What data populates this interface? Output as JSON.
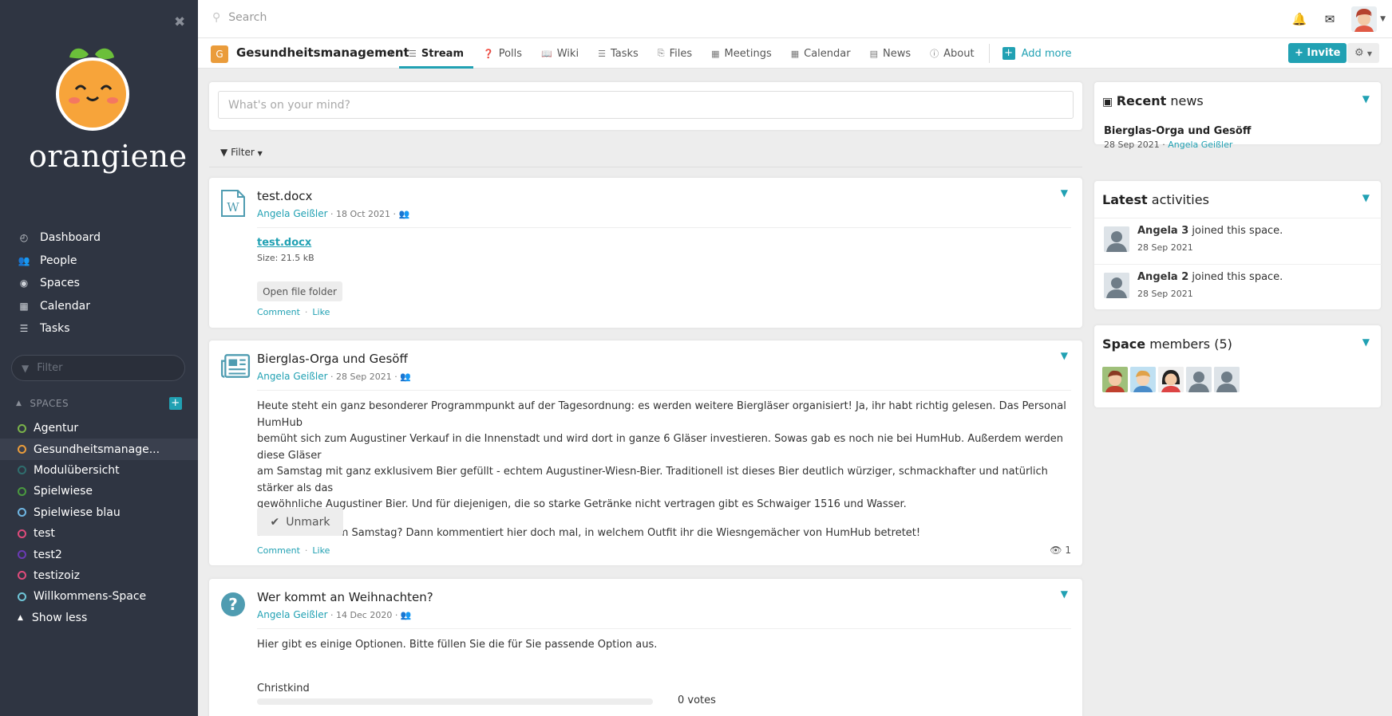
{
  "sidebar": {
    "brand": "orangiene",
    "nav": [
      {
        "label": "Dashboard",
        "icon": "dashboard-icon"
      },
      {
        "label": "People",
        "icon": "people-icon"
      },
      {
        "label": "Spaces",
        "icon": "spaces-icon"
      },
      {
        "label": "Calendar",
        "icon": "calendar-icon"
      },
      {
        "label": "Tasks",
        "icon": "tasks-icon"
      }
    ],
    "filter_placeholder": "Filter",
    "spaces_heading": "SPACES",
    "spaces": [
      {
        "label": "Agentur",
        "color": "#7ab34a"
      },
      {
        "label": "Gesundheitsmanage...",
        "color": "#ea9c3b"
      },
      {
        "label": "Modulübersicht",
        "color": "#2f6e6e"
      },
      {
        "label": "Spielwiese",
        "color": "#4a9a3f"
      },
      {
        "label": "Spielwiese blau",
        "color": "#6fb6e3"
      },
      {
        "label": "test",
        "color": "#e04b7b"
      },
      {
        "label": "test2",
        "color": "#6a3ab5"
      },
      {
        "label": "testizoiz",
        "color": "#e04b7b"
      },
      {
        "label": "Willkommens-Space",
        "color": "#6fc6d8"
      }
    ],
    "show_less": "Show less"
  },
  "topbar": {
    "search_placeholder": "Search"
  },
  "space": {
    "badge": "G",
    "name": "Gesundheitsmanagement",
    "tabs": [
      {
        "label": "Stream",
        "icon": "list-icon"
      },
      {
        "label": "Polls",
        "icon": "question-icon"
      },
      {
        "label": "Wiki",
        "icon": "book-icon"
      },
      {
        "label": "Tasks",
        "icon": "tasks-icon"
      },
      {
        "label": "Files",
        "icon": "files-icon"
      },
      {
        "label": "Meetings",
        "icon": "calendar-icon"
      },
      {
        "label": "Calendar",
        "icon": "calendar-icon"
      },
      {
        "label": "News",
        "icon": "news-icon"
      },
      {
        "label": "About",
        "icon": "info-icon"
      }
    ],
    "add_more": "Add more",
    "invite": "Invite"
  },
  "stream": {
    "composer_placeholder": "What's on your mind?",
    "filter_label": "Filter",
    "posts": [
      {
        "title": "test.docx",
        "author": "Angela Geißler",
        "date": "18 Oct 2021",
        "file_link": "test.docx",
        "file_size": "Size: 21.5 kB",
        "open_folder": "Open file folder",
        "comment": "Comment",
        "like": "Like"
      },
      {
        "title": "Bierglas-Orga und Gesöff",
        "author": "Angela Geißler",
        "date": "28 Sep 2021",
        "lines": [
          "Heute steht ein ganz besonderer Programmpunkt auf der Tagesordnung: es werden weitere Biergläser organisiert! Ja, ihr habt richtig gelesen. Das Personal HumHub",
          "bemüht sich zum Augustiner Verkauf in die Innenstadt und wird dort in ganze 6 Gläser investieren. Sowas gab es noch nie bei HumHub. Außerdem werden diese Gläser",
          "am Samstag mit ganz exklusivem Bier gefüllt - echtem Augustiner-Wiesn-Bier. Traditionell ist dieses Bier deutlich würziger, schmackhafter und natürlich stärker als das",
          "gewöhnliche Augustiner Bier. Und für diejenigen, die so starke Getränke nicht vertragen gibt es Schwaiger 1516 und Wasser."
        ],
        "paragraph2": "Seid ihr dabei am Samstag? Dann kommentiert hier doch mal, in welchem Outfit ihr die Wiesngemächer von HumHub betretet!",
        "unmark": "Unmark",
        "comment": "Comment",
        "like": "Like",
        "views": "1"
      },
      {
        "title": "Wer kommt an Weihnachten?",
        "author": "Angela Geißler",
        "date": "14 Dec 2020",
        "text": "Hier gibt es einige Optionen. Bitte füllen Sie die für Sie passende Option aus.",
        "option_label": "Christkind",
        "option_votes": "0 votes",
        "option_progress": 0
      }
    ]
  },
  "right": {
    "recent_news": {
      "title_bold": "Recent",
      "title_rest": "news",
      "item_title": "Bierglas-Orga und Gesöff",
      "item_date": "28 Sep 2021",
      "item_author": "Angela Geißler"
    },
    "latest": {
      "title_bold": "Latest",
      "title_rest": "activities",
      "items": [
        {
          "name": "Angela 3",
          "action": "joined this space.",
          "date": "28 Sep 2021"
        },
        {
          "name": "Angela 2",
          "action": "joined this space.",
          "date": "28 Sep 2021"
        }
      ]
    },
    "members": {
      "title_bold": "Space",
      "title_rest": "members (5)"
    }
  },
  "colors": {
    "accent": "#21a1b3",
    "sidebar_bg": "#2f3542",
    "space_badge": "#ea9c3b"
  }
}
